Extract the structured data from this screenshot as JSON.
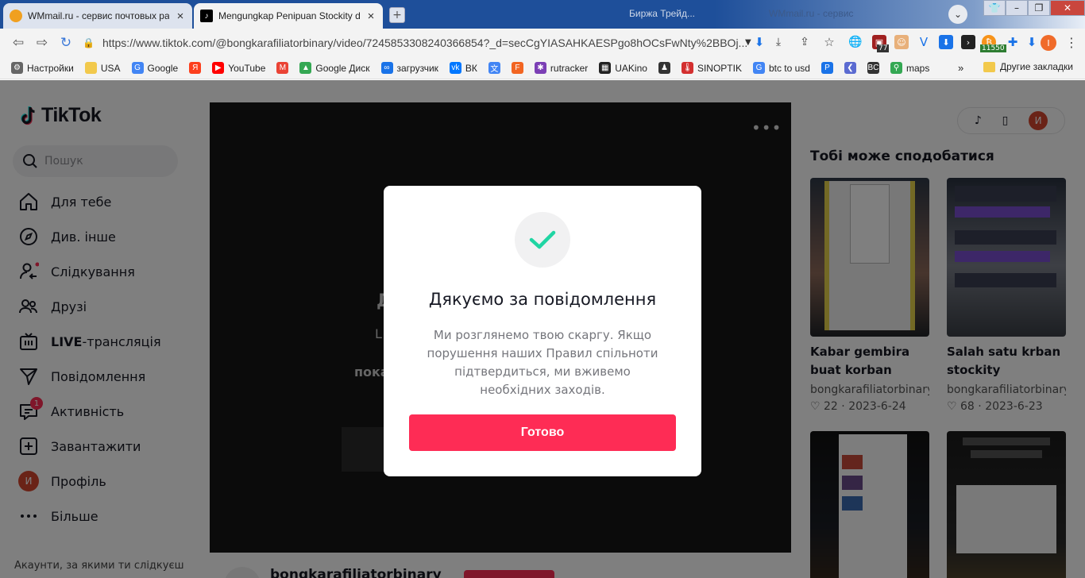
{
  "browser": {
    "tabs": [
      {
        "title": "WMmail.ru - сервис почтовых рас",
        "active": false
      },
      {
        "title": "Mengungkap Penipuan Stockity da",
        "active": true
      }
    ],
    "ghost_tabs": [
      "Биржа Трейд...",
      "WMmail.ru - сервис"
    ],
    "url": "https://www.tiktok.com/@bongkarafiliatorbinary/video/7245853308240366854?_d=secCgYIASAHKAESPgo8hOCsFwNty%2BBOj...",
    "ext_badge_1": "77",
    "ext_badge_2": "11550",
    "profile_initial": "I"
  },
  "bookmarks": [
    {
      "label": "Настройки",
      "icon": "gear-icon",
      "color": "#666666"
    },
    {
      "label": "USA",
      "icon": "folder-icon",
      "color": "#f2c94c"
    },
    {
      "label": "Google",
      "icon": "google-icon",
      "color": "#4285f4"
    },
    {
      "label": "",
      "icon": "yandex-icon",
      "color": "#fc3f1d"
    },
    {
      "label": "YouTube",
      "icon": "youtube-icon",
      "color": "#ff0000"
    },
    {
      "label": "",
      "icon": "gmail-icon",
      "color": "#ea4335"
    },
    {
      "label": "Google Диск",
      "icon": "drive-icon",
      "color": "#34a853"
    },
    {
      "label": "загрузчик",
      "icon": "infinity-icon",
      "color": "#1a73e8"
    },
    {
      "label": "ВК",
      "icon": "vk-icon",
      "color": "#0077ff"
    },
    {
      "label": "",
      "icon": "translate-icon",
      "color": "#4285f4"
    },
    {
      "label": "",
      "icon": "f-icon",
      "color": "#f26522"
    },
    {
      "label": "rutracker",
      "icon": "rutracker-icon",
      "color": "#7b3fb5"
    },
    {
      "label": "UAKino",
      "icon": "film-icon",
      "color": "#222222"
    },
    {
      "label": "",
      "icon": "figure-icon",
      "color": "#333333"
    },
    {
      "label": "SINOPTIK",
      "icon": "thermometer-icon",
      "color": "#d32f2f"
    },
    {
      "label": "btc to usd",
      "icon": "google-icon",
      "color": "#4285f4"
    },
    {
      "label": "",
      "icon": "p-icon",
      "color": "#1a73e8"
    },
    {
      "label": "",
      "icon": "arrow-left-icon",
      "color": "#5b6bd1"
    },
    {
      "label": "",
      "icon": "bc-icon",
      "color": "#333333"
    },
    {
      "label": "maps",
      "icon": "maps-pin-icon",
      "color": "#34a853"
    }
  ],
  "bookmarks_more": "»",
  "bookmarks_other": "Другие закладки",
  "tiktok": {
    "logo": "TikTok",
    "search_placeholder": "Пошук",
    "nav": [
      {
        "label": "Для тебе",
        "icon": "home-icon"
      },
      {
        "label": "Див. інше",
        "icon": "compass-icon"
      },
      {
        "label": "Слідкування",
        "icon": "following-icon"
      },
      {
        "label": "Друзі",
        "icon": "friends-icon"
      },
      {
        "label": "LIVE-трансляція",
        "icon": "live-icon"
      },
      {
        "label": "Повідомлення",
        "icon": "send-icon"
      },
      {
        "label": "Активність",
        "icon": "activity-icon",
        "badge": "1"
      },
      {
        "label": "Завантажити",
        "icon": "upload-icon"
      },
      {
        "label": "Профіль",
        "icon": "avatar",
        "initial": "И"
      },
      {
        "label": "Більше",
        "icon": "more-icon"
      }
    ],
    "following_note": "Акаунти, за якими ти слідкуєш",
    "profile_initial": "И",
    "video_author": "bongkarafiliatorbinary",
    "recommend_title": "Тобі може сподобатися",
    "cards": [
      {
        "title": "Kabar gembira buat korban afiliator…",
        "user": "bongkarafiliatorbinary",
        "likes": "22",
        "date": "2023-6-24"
      },
      {
        "title": "Salah satu krban stockity penipuan…",
        "user": "bongkarafiliatorbinary",
        "likes": "68",
        "date": "2023-6-23"
      },
      {
        "title": "",
        "user": "",
        "likes": "",
        "date": ""
      },
      {
        "title": "",
        "user": "",
        "likes": "",
        "date": ""
      }
    ]
  },
  "modal": {
    "title": "Дякуємо за повідомлення",
    "body": "Ми розглянемо твою скаргу. Якщо порушення наших Правил спільноти підтвердиться, ми вживемо необхідних заходів.",
    "button": "Готово",
    "accent": "#fe2c55",
    "check_color": "#20d5a3"
  }
}
